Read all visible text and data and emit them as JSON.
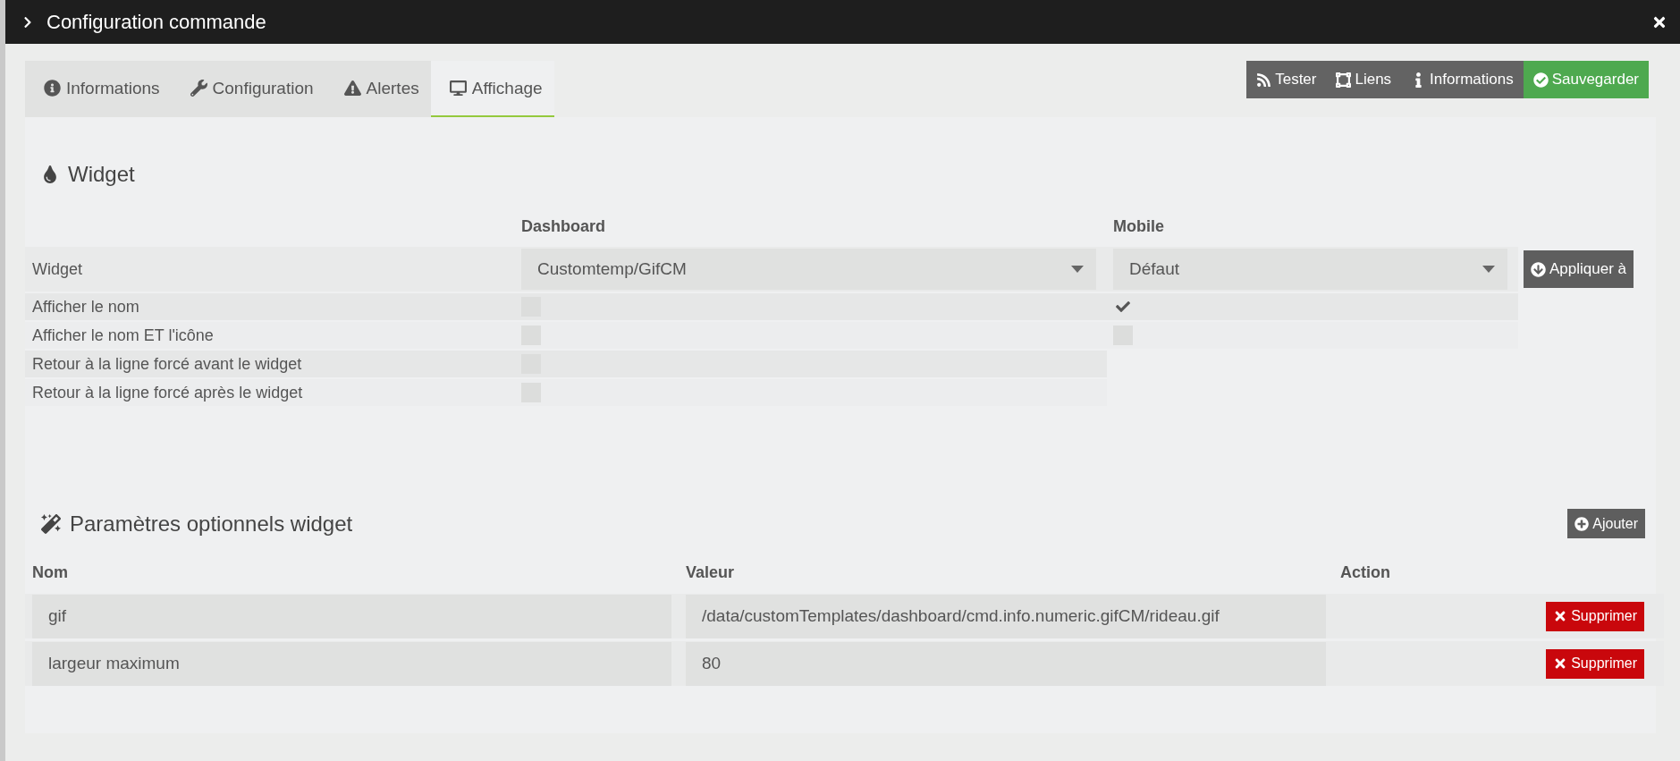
{
  "window": {
    "title": "Configuration commande"
  },
  "tabs": [
    {
      "label": "Informations",
      "selected": false
    },
    {
      "label": "Configuration",
      "selected": false
    },
    {
      "label": "Alertes",
      "selected": false
    },
    {
      "label": "Affichage",
      "selected": true
    }
  ],
  "actions": [
    {
      "label": "Tester",
      "kind": "default"
    },
    {
      "label": "Liens",
      "kind": "default"
    },
    {
      "label": "Informations",
      "kind": "default"
    },
    {
      "label": "Sauvegarder",
      "kind": "success"
    }
  ],
  "widget": {
    "title": "Widget",
    "columns": [
      "Dashboard",
      "Mobile"
    ],
    "select_row": {
      "label": "Widget",
      "dashboard": "Customtemp/GifCM",
      "mobile": "Défaut",
      "button": "Appliquer à"
    },
    "options": [
      {
        "label": "Afficher le nom",
        "dashboard": false,
        "mobile": true
      },
      {
        "label": "Afficher le nom ET l'icône",
        "dashboard": false,
        "mobile": false
      },
      {
        "label": "Retour à la ligne forcé avant le widget",
        "dashboard": false
      },
      {
        "label": "Retour à la ligne forcé après le widget",
        "dashboard": false
      }
    ]
  },
  "parameters": {
    "title": "Paramètres optionnels widget",
    "add_button": "Ajouter",
    "columns": [
      "Nom",
      "Valeur",
      "Action"
    ],
    "rows": [
      {
        "name": "gif",
        "value": "/data/customTemplates/dashboard/cmd.info.numeric.gifCM/rideau.gif",
        "button": "Supprimer"
      },
      {
        "name": "largeur maximum",
        "value": "80",
        "button": "Supprimer"
      }
    ]
  }
}
